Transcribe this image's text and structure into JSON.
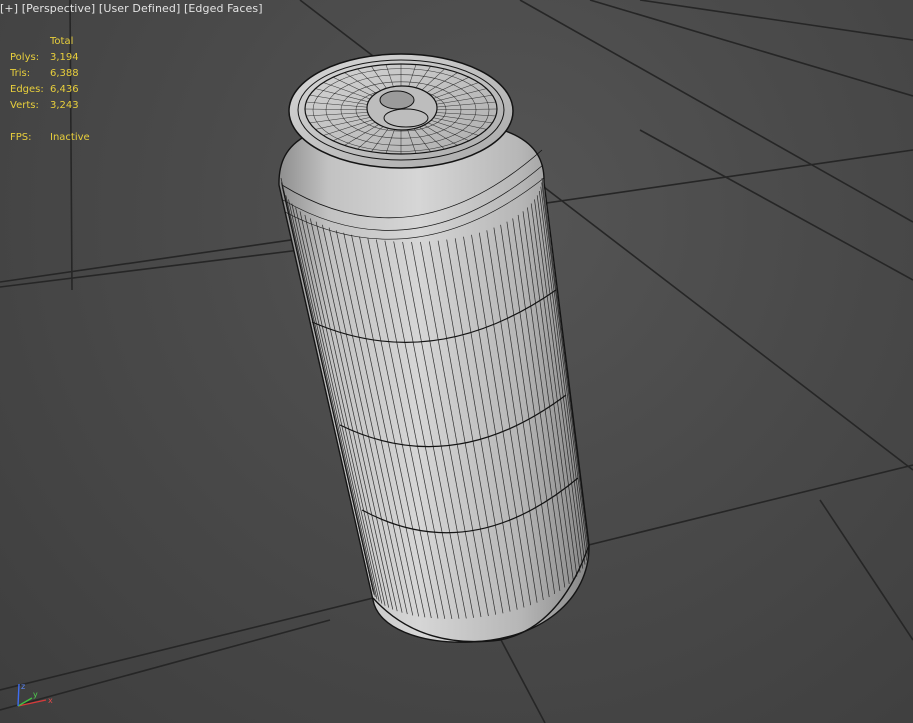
{
  "viewport": {
    "label_plus": "[+]",
    "label_view": "[Perspective]",
    "label_camera": "[User Defined]",
    "label_shading": "[Edged Faces]"
  },
  "stats": {
    "header": "Total",
    "polys_label": "Polys:",
    "polys_value": "3,194",
    "tris_label": "Tris:",
    "tris_value": "6,388",
    "edges_label": "Edges:",
    "edges_value": "6,436",
    "verts_label": "Verts:",
    "verts_value": "3,243",
    "fps_label": "FPS:",
    "fps_value": "Inactive"
  },
  "gizmo": {
    "x_label": "x",
    "y_label": "y",
    "z_label": "z"
  },
  "colors": {
    "background": "#4a4a4a",
    "grid": "#262626",
    "stats_text": "#e8cf3c",
    "label_text": "#e4e4e4",
    "mesh_fill": "#c4c4c4",
    "wire": "#141414"
  }
}
